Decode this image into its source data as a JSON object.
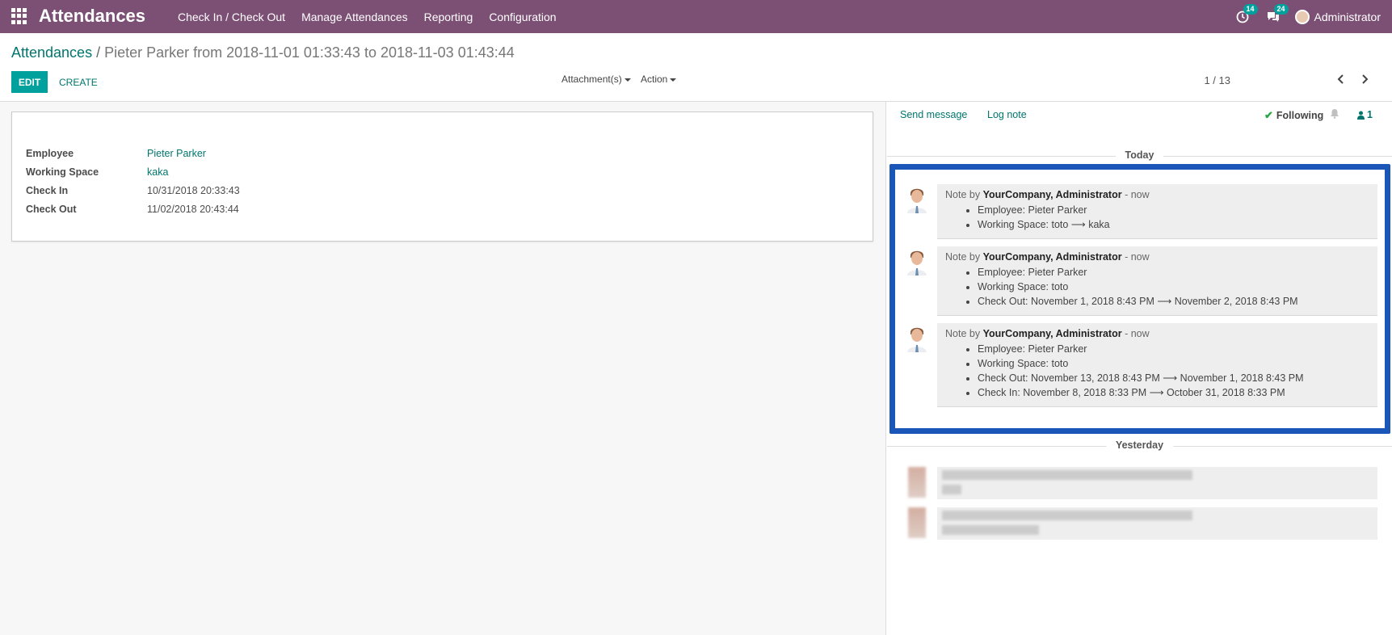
{
  "navbar": {
    "app_title": "Attendances",
    "menu": [
      "Check In / Check Out",
      "Manage Attendances",
      "Reporting",
      "Configuration"
    ],
    "activity_count": "14",
    "messages_count": "24",
    "user_name": "Administrator",
    "background_color": "#7c5074"
  },
  "breadcrumb": {
    "parent": "Attendances",
    "separator": "/",
    "current": "Pieter Parker from 2018-11-01 01:33:43 to 2018-11-03 01:43:44"
  },
  "buttons": {
    "edit": "EDIT",
    "create": "CREATE"
  },
  "sidebar": {
    "attachments": "Attachment(s)",
    "action": "Action"
  },
  "pager": {
    "value": "1 / 13"
  },
  "form": {
    "fields": [
      {
        "label": "Employee",
        "value": "Pieter Parker"
      },
      {
        "label": "Working Space",
        "value": "kaka"
      },
      {
        "label": "Check In",
        "value": "10/31/2018 20:33:43"
      },
      {
        "label": "Check Out",
        "value": "11/02/2018 20:43:44"
      }
    ]
  },
  "chatter": {
    "send_message": "Send message",
    "log_note": "Log note",
    "following": "Following",
    "followers_count": "1",
    "today_label": "Today",
    "yesterday_label": "Yesterday",
    "highlight_color": "#1a56b7",
    "messages": [
      {
        "prefix": "Note by",
        "author": "YourCompany, Administrator",
        "time": "- now",
        "changes": [
          "Employee: Pieter Parker",
          "Working Space: toto ⟶ kaka"
        ]
      },
      {
        "prefix": "Note by",
        "author": "YourCompany, Administrator",
        "time": "- now",
        "changes": [
          "Employee: Pieter Parker",
          "Working Space: toto",
          "Check Out: November 1, 2018 8:43 PM ⟶ November 2, 2018 8:43 PM"
        ]
      },
      {
        "prefix": "Note by",
        "author": "YourCompany, Administrator",
        "time": "- now",
        "changes": [
          "Employee: Pieter Parker",
          "Working Space: toto",
          "Check Out: November 13, 2018 8:43 PM ⟶ November 1, 2018 8:43 PM",
          "Check In: November 8, 2018 8:33 PM ⟶ October 31, 2018 8:33 PM"
        ]
      }
    ]
  }
}
